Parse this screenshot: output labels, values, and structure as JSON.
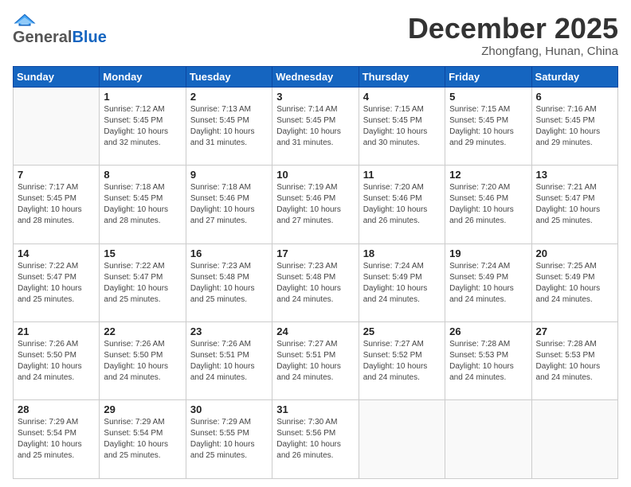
{
  "header": {
    "logo_general": "General",
    "logo_blue": "Blue",
    "month": "December 2025",
    "location": "Zhongfang, Hunan, China"
  },
  "days_of_week": [
    "Sunday",
    "Monday",
    "Tuesday",
    "Wednesday",
    "Thursday",
    "Friday",
    "Saturday"
  ],
  "weeks": [
    [
      {
        "day": "",
        "info": ""
      },
      {
        "day": "1",
        "info": "Sunrise: 7:12 AM\nSunset: 5:45 PM\nDaylight: 10 hours\nand 32 minutes."
      },
      {
        "day": "2",
        "info": "Sunrise: 7:13 AM\nSunset: 5:45 PM\nDaylight: 10 hours\nand 31 minutes."
      },
      {
        "day": "3",
        "info": "Sunrise: 7:14 AM\nSunset: 5:45 PM\nDaylight: 10 hours\nand 31 minutes."
      },
      {
        "day": "4",
        "info": "Sunrise: 7:15 AM\nSunset: 5:45 PM\nDaylight: 10 hours\nand 30 minutes."
      },
      {
        "day": "5",
        "info": "Sunrise: 7:15 AM\nSunset: 5:45 PM\nDaylight: 10 hours\nand 29 minutes."
      },
      {
        "day": "6",
        "info": "Sunrise: 7:16 AM\nSunset: 5:45 PM\nDaylight: 10 hours\nand 29 minutes."
      }
    ],
    [
      {
        "day": "7",
        "info": "Sunrise: 7:17 AM\nSunset: 5:45 PM\nDaylight: 10 hours\nand 28 minutes."
      },
      {
        "day": "8",
        "info": "Sunrise: 7:18 AM\nSunset: 5:45 PM\nDaylight: 10 hours\nand 28 minutes."
      },
      {
        "day": "9",
        "info": "Sunrise: 7:18 AM\nSunset: 5:46 PM\nDaylight: 10 hours\nand 27 minutes."
      },
      {
        "day": "10",
        "info": "Sunrise: 7:19 AM\nSunset: 5:46 PM\nDaylight: 10 hours\nand 27 minutes."
      },
      {
        "day": "11",
        "info": "Sunrise: 7:20 AM\nSunset: 5:46 PM\nDaylight: 10 hours\nand 26 minutes."
      },
      {
        "day": "12",
        "info": "Sunrise: 7:20 AM\nSunset: 5:46 PM\nDaylight: 10 hours\nand 26 minutes."
      },
      {
        "day": "13",
        "info": "Sunrise: 7:21 AM\nSunset: 5:47 PM\nDaylight: 10 hours\nand 25 minutes."
      }
    ],
    [
      {
        "day": "14",
        "info": "Sunrise: 7:22 AM\nSunset: 5:47 PM\nDaylight: 10 hours\nand 25 minutes."
      },
      {
        "day": "15",
        "info": "Sunrise: 7:22 AM\nSunset: 5:47 PM\nDaylight: 10 hours\nand 25 minutes."
      },
      {
        "day": "16",
        "info": "Sunrise: 7:23 AM\nSunset: 5:48 PM\nDaylight: 10 hours\nand 25 minutes."
      },
      {
        "day": "17",
        "info": "Sunrise: 7:23 AM\nSunset: 5:48 PM\nDaylight: 10 hours\nand 24 minutes."
      },
      {
        "day": "18",
        "info": "Sunrise: 7:24 AM\nSunset: 5:49 PM\nDaylight: 10 hours\nand 24 minutes."
      },
      {
        "day": "19",
        "info": "Sunrise: 7:24 AM\nSunset: 5:49 PM\nDaylight: 10 hours\nand 24 minutes."
      },
      {
        "day": "20",
        "info": "Sunrise: 7:25 AM\nSunset: 5:49 PM\nDaylight: 10 hours\nand 24 minutes."
      }
    ],
    [
      {
        "day": "21",
        "info": "Sunrise: 7:26 AM\nSunset: 5:50 PM\nDaylight: 10 hours\nand 24 minutes."
      },
      {
        "day": "22",
        "info": "Sunrise: 7:26 AM\nSunset: 5:50 PM\nDaylight: 10 hours\nand 24 minutes."
      },
      {
        "day": "23",
        "info": "Sunrise: 7:26 AM\nSunset: 5:51 PM\nDaylight: 10 hours\nand 24 minutes."
      },
      {
        "day": "24",
        "info": "Sunrise: 7:27 AM\nSunset: 5:51 PM\nDaylight: 10 hours\nand 24 minutes."
      },
      {
        "day": "25",
        "info": "Sunrise: 7:27 AM\nSunset: 5:52 PM\nDaylight: 10 hours\nand 24 minutes."
      },
      {
        "day": "26",
        "info": "Sunrise: 7:28 AM\nSunset: 5:53 PM\nDaylight: 10 hours\nand 24 minutes."
      },
      {
        "day": "27",
        "info": "Sunrise: 7:28 AM\nSunset: 5:53 PM\nDaylight: 10 hours\nand 24 minutes."
      }
    ],
    [
      {
        "day": "28",
        "info": "Sunrise: 7:29 AM\nSunset: 5:54 PM\nDaylight: 10 hours\nand 25 minutes."
      },
      {
        "day": "29",
        "info": "Sunrise: 7:29 AM\nSunset: 5:54 PM\nDaylight: 10 hours\nand 25 minutes."
      },
      {
        "day": "30",
        "info": "Sunrise: 7:29 AM\nSunset: 5:55 PM\nDaylight: 10 hours\nand 25 minutes."
      },
      {
        "day": "31",
        "info": "Sunrise: 7:30 AM\nSunset: 5:56 PM\nDaylight: 10 hours\nand 26 minutes."
      },
      {
        "day": "",
        "info": ""
      },
      {
        "day": "",
        "info": ""
      },
      {
        "day": "",
        "info": ""
      }
    ]
  ]
}
